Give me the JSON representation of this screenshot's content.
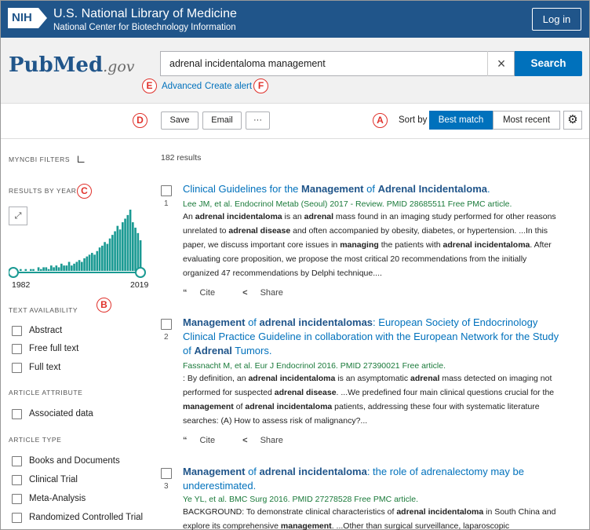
{
  "header": {
    "nih_logo": "NIH",
    "title": "U.S. National Library of Medicine",
    "subtitle": "National Center for Biotechnology Information",
    "login_label": "Log in"
  },
  "search": {
    "logo_main": "PubMed",
    "logo_suffix": ".gov",
    "query": "adrenal incidentaloma management",
    "clear_icon": "×",
    "button_label": "Search",
    "advanced_label": "Advanced",
    "create_alert_label": "Create alert"
  },
  "toolbar": {
    "save_label": "Save",
    "email_label": "Email",
    "more_label": "···",
    "sort_label": "Sort by",
    "sort_best": "Best match",
    "sort_recent": "Most recent",
    "gear_icon": "⚙"
  },
  "markers": {
    "a": "A",
    "b": "B",
    "c": "C",
    "d": "D",
    "e": "E",
    "f": "F"
  },
  "sidebar": {
    "myncbi_filters": "MYNCBI FILTERS",
    "results_by_year": "RESULTS BY YEAR",
    "expand_icon": "⤢",
    "year_start": "1982",
    "year_end": "2019",
    "histogram_counts": [
      1,
      0,
      1,
      0,
      1,
      1,
      0,
      2,
      1,
      2,
      2,
      1,
      3,
      2,
      3,
      2,
      4,
      3,
      3,
      5,
      3,
      4,
      5,
      6,
      5,
      7,
      8,
      9,
      10,
      9,
      11,
      13,
      14,
      16,
      15,
      18,
      20,
      22,
      25,
      23,
      27,
      29,
      31,
      34,
      27,
      24,
      21,
      17
    ],
    "text_availability": "TEXT AVAILABILITY",
    "text_filters": [
      "Abstract",
      "Free full text",
      "Full text"
    ],
    "article_attribute": "ARTICLE ATTRIBUTE",
    "attribute_filters": [
      "Associated data"
    ],
    "article_type": "ARTICLE TYPE",
    "type_filters": [
      "Books and Documents",
      "Clinical Trial",
      "Meta-Analysis",
      "Randomized Controlled Trial"
    ]
  },
  "results": {
    "count": "182 results",
    "cite_label": "Cite",
    "share_label": "Share",
    "articles": [
      {
        "num": "1",
        "citation": "Lee JM, et al. Endocrinol Metab (Seoul) 2017 - Review. PMID 28685511 Free PMC article."
      },
      {
        "num": "2",
        "citation": "Fassnacht M, et al. Eur J Endocrinol 2016. PMID 27390021 Free article."
      },
      {
        "num": "3",
        "citation": "Ye YL, et al. BMC Surg 2016. PMID 27278528 Free PMC article."
      }
    ]
  }
}
